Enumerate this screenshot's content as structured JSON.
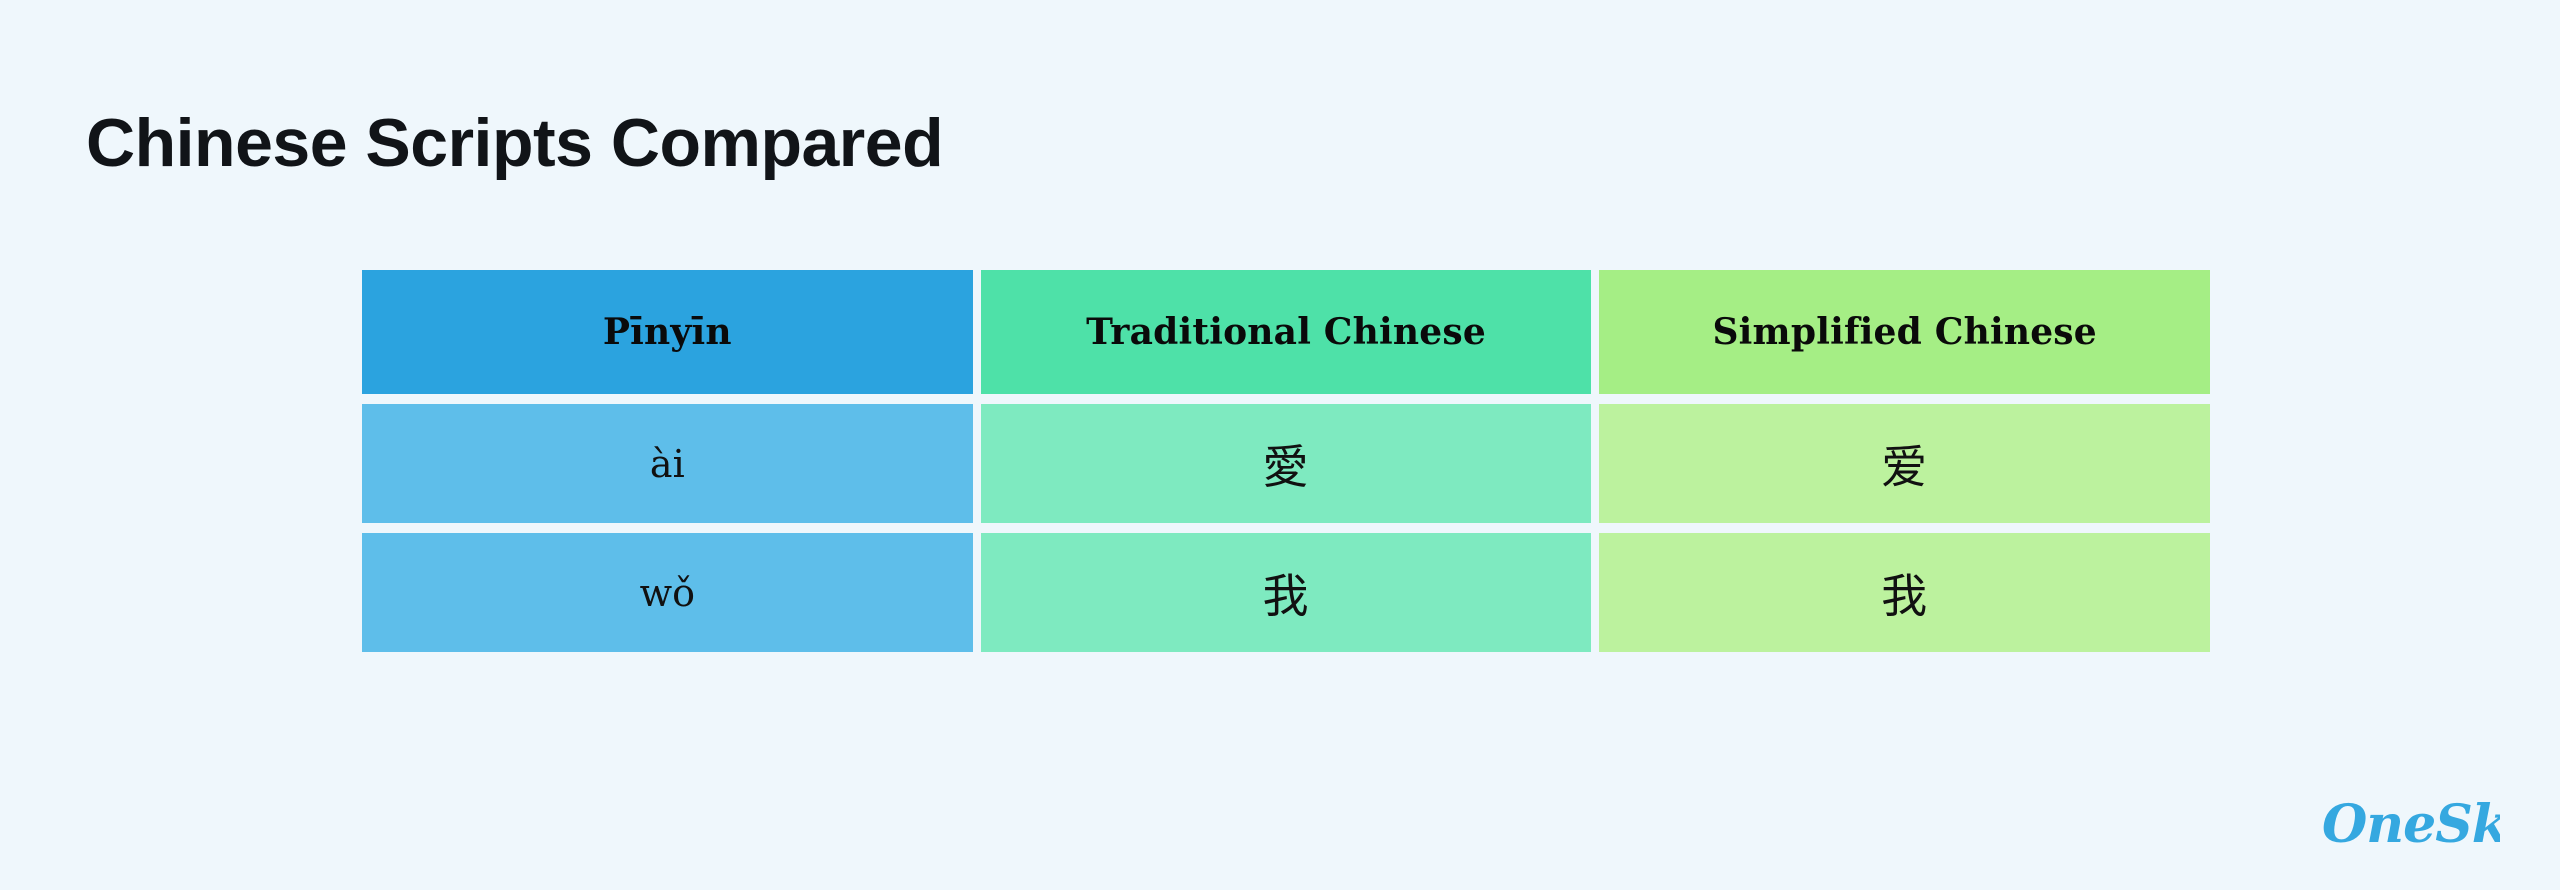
{
  "slide": {
    "background_color": "#eff7fc",
    "title": "Chinese Scripts Compared"
  },
  "table": {
    "columns": [
      {
        "key": "pinyin",
        "header": "Pīnyīn",
        "header_color": "#2ba3df",
        "cell_color": "#5ebeea"
      },
      {
        "key": "traditional",
        "header": "Traditional Chinese",
        "header_color": "#4ee1a8",
        "cell_color": "#7eeac0"
      },
      {
        "key": "simplified",
        "header": "Simplified Chinese",
        "header_color": "#a5ee85",
        "cell_color": "#bcf29e"
      }
    ],
    "rows": [
      {
        "pinyin": "ài",
        "traditional": "愛",
        "simplified": "爱"
      },
      {
        "pinyin": "wǒ",
        "traditional": "我",
        "simplified": "我"
      }
    ]
  },
  "branding": {
    "logo_text": "OneSky",
    "logo_color": "#35a8e0"
  }
}
